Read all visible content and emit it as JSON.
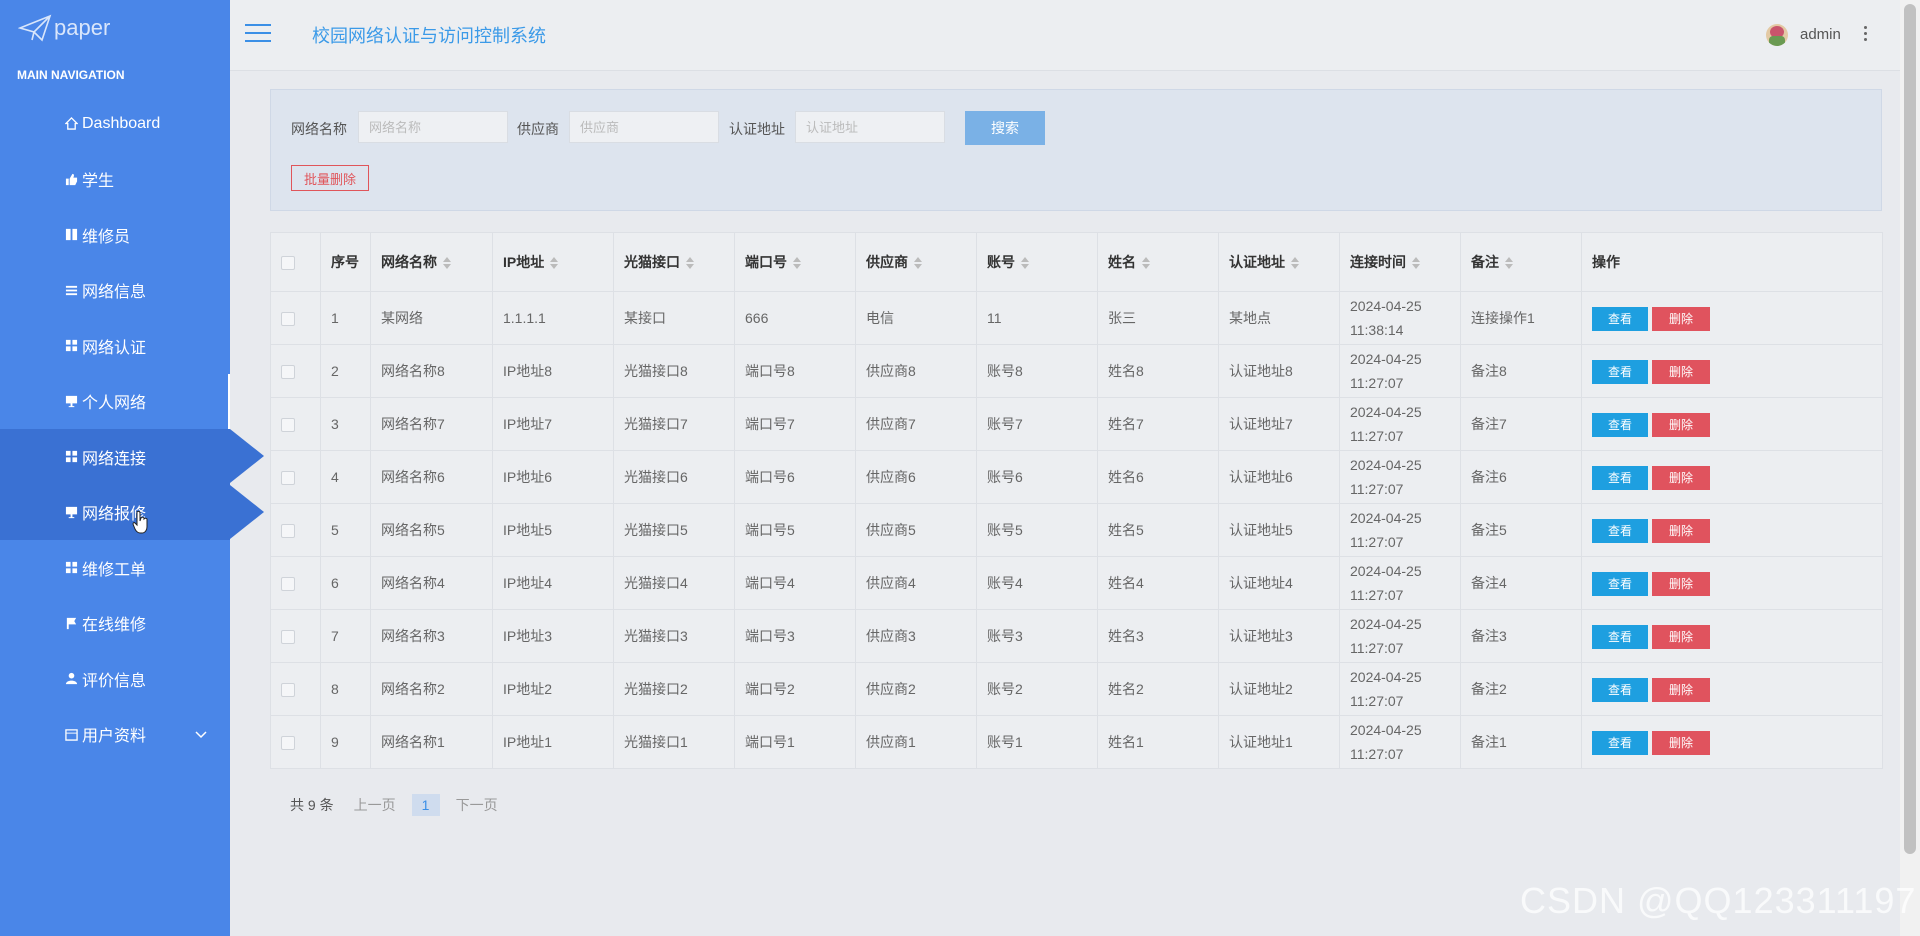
{
  "app": {
    "logo_text": "paper",
    "title": "校园网络认证与访问控制系统",
    "user": "admin"
  },
  "sidebar": {
    "heading": "MAIN NAVIGATION",
    "items": [
      {
        "label": "Dashboard",
        "icon": "home-icon"
      },
      {
        "label": "学生",
        "icon": "thumbs-up-icon"
      },
      {
        "label": "维修员",
        "icon": "book-icon"
      },
      {
        "label": "网络信息",
        "icon": "list-icon"
      },
      {
        "label": "网络认证",
        "icon": "grid-icon"
      },
      {
        "label": "个人网络",
        "icon": "monitor-icon"
      },
      {
        "label": "网络连接",
        "icon": "grid-icon"
      },
      {
        "label": "网络报修",
        "icon": "monitor-icon"
      },
      {
        "label": "维修工单",
        "icon": "grid-icon"
      },
      {
        "label": "在线维修",
        "icon": "flag-icon"
      },
      {
        "label": "评价信息",
        "icon": "user-icon"
      },
      {
        "label": "用户资料",
        "icon": "calendar-icon"
      }
    ]
  },
  "search": {
    "name_label": "网络名称",
    "name_placeholder": "网络名称",
    "supplier_label": "供应商",
    "supplier_placeholder": "供应商",
    "auth_label": "认证地址",
    "auth_placeholder": "认证地址",
    "search_btn": "搜索",
    "batch_delete": "批量删除"
  },
  "table": {
    "columns": [
      "序号",
      "网络名称",
      "IP地址",
      "光猫接口",
      "端口号",
      "供应商",
      "账号",
      "姓名",
      "认证地址",
      "连接时间",
      "备注",
      "操作"
    ],
    "view_label": "查看",
    "delete_label": "删除",
    "rows": [
      [
        "1",
        "某网络",
        "1.1.1.1",
        "某接口",
        "666",
        "电信",
        "11",
        "张三",
        "某地点",
        "2024-04-25 11:38:14",
        "连接操作1"
      ],
      [
        "2",
        "网络名称8",
        "IP地址8",
        "光猫接口8",
        "端口号8",
        "供应商8",
        "账号8",
        "姓名8",
        "认证地址8",
        "2024-04-25 11:27:07",
        "备注8"
      ],
      [
        "3",
        "网络名称7",
        "IP地址7",
        "光猫接口7",
        "端口号7",
        "供应商7",
        "账号7",
        "姓名7",
        "认证地址7",
        "2024-04-25 11:27:07",
        "备注7"
      ],
      [
        "4",
        "网络名称6",
        "IP地址6",
        "光猫接口6",
        "端口号6",
        "供应商6",
        "账号6",
        "姓名6",
        "认证地址6",
        "2024-04-25 11:27:07",
        "备注6"
      ],
      [
        "5",
        "网络名称5",
        "IP地址5",
        "光猫接口5",
        "端口号5",
        "供应商5",
        "账号5",
        "姓名5",
        "认证地址5",
        "2024-04-25 11:27:07",
        "备注5"
      ],
      [
        "6",
        "网络名称4",
        "IP地址4",
        "光猫接口4",
        "端口号4",
        "供应商4",
        "账号4",
        "姓名4",
        "认证地址4",
        "2024-04-25 11:27:07",
        "备注4"
      ],
      [
        "7",
        "网络名称3",
        "IP地址3",
        "光猫接口3",
        "端口号3",
        "供应商3",
        "账号3",
        "姓名3",
        "认证地址3",
        "2024-04-25 11:27:07",
        "备注3"
      ],
      [
        "8",
        "网络名称2",
        "IP地址2",
        "光猫接口2",
        "端口号2",
        "供应商2",
        "账号2",
        "姓名2",
        "认证地址2",
        "2024-04-25 11:27:07",
        "备注2"
      ],
      [
        "9",
        "网络名称1",
        "IP地址1",
        "光猫接口1",
        "端口号1",
        "供应商1",
        "账号1",
        "姓名1",
        "认证地址1",
        "2024-04-25 11:27:07",
        "备注1"
      ]
    ]
  },
  "pager": {
    "total": "共 9 条",
    "prev": "上一页",
    "current": "1",
    "next": "下一页"
  },
  "watermark": "CSDN @QQ123311197",
  "colors": {
    "sidebar": "#4a86e8",
    "accent": "#3b9ae8",
    "view_button": "#1e9fe0",
    "delete_button": "#e0535e"
  }
}
